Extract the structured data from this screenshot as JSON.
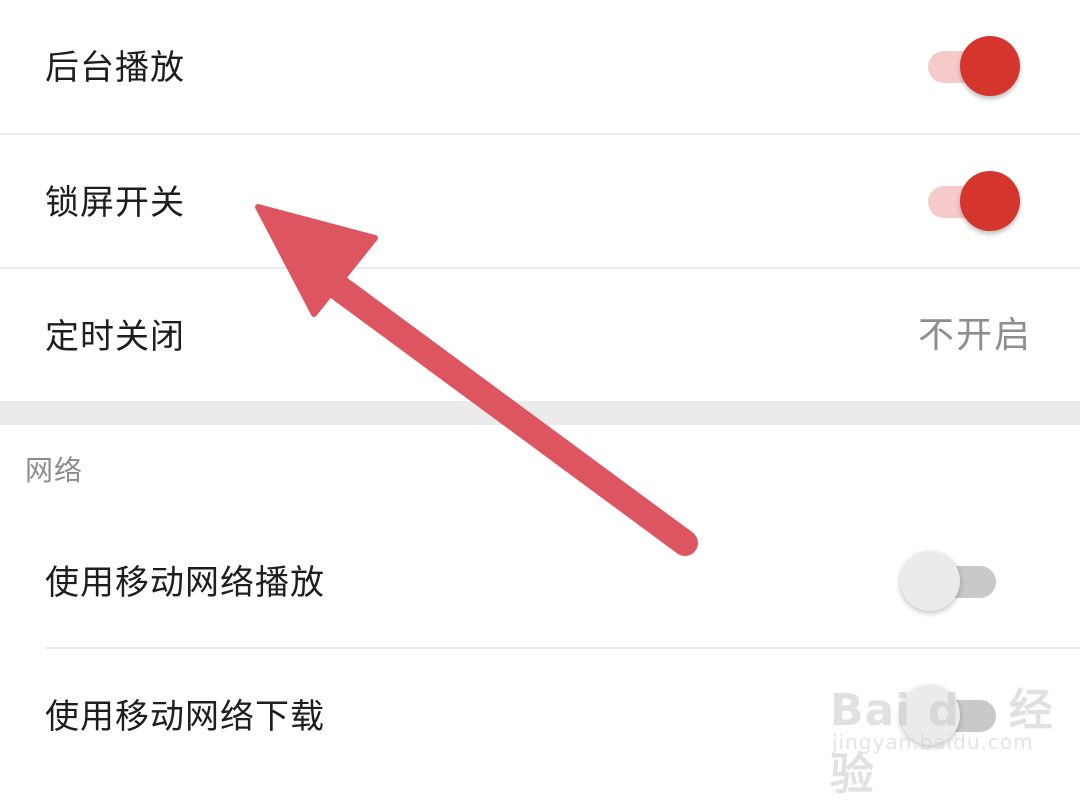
{
  "settings": {
    "background_play": {
      "label": "后台播放",
      "enabled": true
    },
    "lock_screen": {
      "label": "锁屏开关",
      "enabled": true
    },
    "sleep_timer": {
      "label": "定时关闭",
      "value": "不开启"
    }
  },
  "network": {
    "section_title": "网络",
    "mobile_play": {
      "label": "使用移动网络播放",
      "enabled": false
    },
    "mobile_download": {
      "label": "使用移动网络下载",
      "enabled": false
    }
  },
  "annotation": {
    "arrow_color": "#dd5560",
    "arrow_icon": "arrow-up-left-icon"
  },
  "watermark": {
    "brand": "Bai du 经验",
    "site": "jingyan.baidu.com"
  },
  "colors": {
    "accent": "#d4352d",
    "track_on": "#f6caca",
    "track_off": "#c9c9c9"
  }
}
